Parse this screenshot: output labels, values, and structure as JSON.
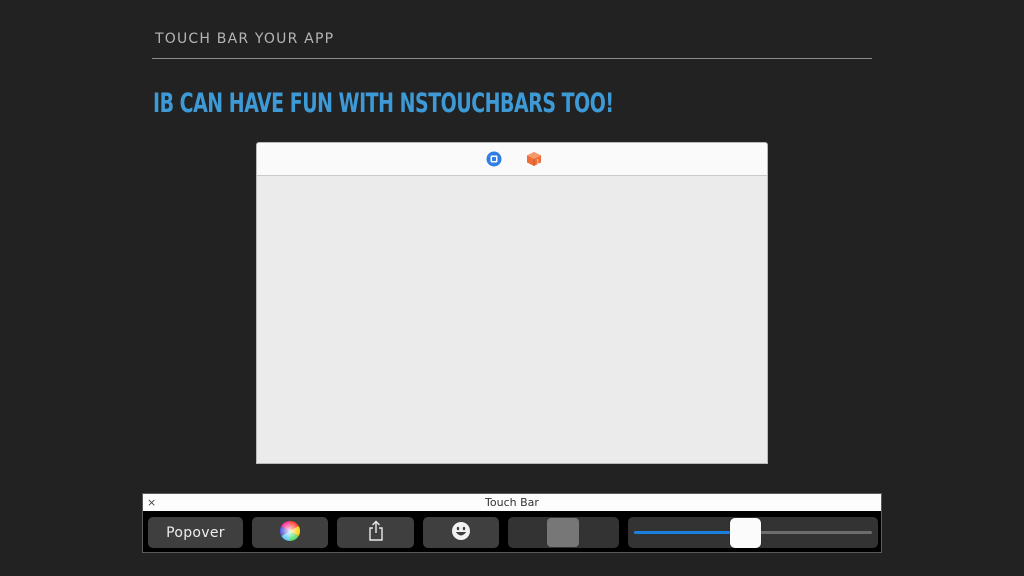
{
  "slide": {
    "header": "TOUCH BAR YOUR APP",
    "title": "IB CAN HAVE FUN WITH NSTOUCHBARS TOO!"
  },
  "ib_canvas": {
    "dock_icons": [
      "first-responder-icon",
      "app-object-icon"
    ],
    "colors": {
      "first_responder": "#2f7ee6",
      "app_object": "#ee6e3a"
    }
  },
  "touch_bar": {
    "window_title": "Touch Bar",
    "close_glyph": "×",
    "items": {
      "popover_label": "Popover",
      "color_picker_icon": "color-wheel-icon",
      "share_icon": "share-icon",
      "emoji_icon": "emoji-icon"
    },
    "slider": {
      "value": 0.47,
      "fill_color": "#1b7fe0"
    }
  }
}
